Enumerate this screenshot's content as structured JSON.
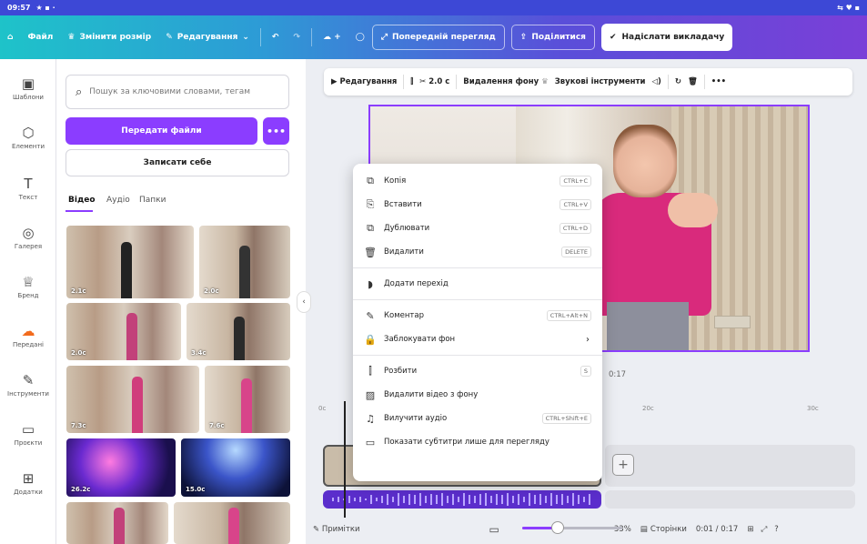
{
  "status": {
    "time": "09:57",
    "right": "⇆ ♥ ▪"
  },
  "topbar": {
    "home_icon": "home-icon",
    "file": "Файл",
    "resize": "Змінити розмір",
    "edit": "Редагування",
    "preview": "Попередній перегляд",
    "share": "Поділитися",
    "send": "Надіслати викладачу"
  },
  "rail": [
    {
      "label": "Шаблони",
      "icon": "▣"
    },
    {
      "label": "Елементи",
      "icon": "⬡"
    },
    {
      "label": "Текст",
      "icon": "T"
    },
    {
      "label": "Галерея",
      "icon": "◎"
    },
    {
      "label": "Бренд",
      "icon": "♕"
    },
    {
      "label": "Передані",
      "icon": "☁"
    },
    {
      "label": "Інструменти",
      "icon": "✎"
    },
    {
      "label": "Проєкти",
      "icon": "▭"
    },
    {
      "label": "Додатки",
      "icon": "⊞"
    }
  ],
  "panel": {
    "search_placeholder": "Пошук за ключовими словами, тегам",
    "upload": "Передати файли",
    "upload_more": "•••",
    "record": "Записати себе",
    "tabs": [
      "Відео",
      "Аудіо",
      "Папки"
    ],
    "thumbs": [
      "2.1с",
      "2.0с",
      "2.0с",
      "3.4с",
      "7.3с",
      "7.6с",
      "26.2с",
      "15.0с"
    ]
  },
  "ctxbar": {
    "edit": "Редагування",
    "duration": "2.0 с",
    "bg_remove": "Видалення фону",
    "audio_tools": "Звукові інструменти"
  },
  "menu": [
    {
      "icon": "⧉",
      "label": "Копія",
      "shortcut": "CTRL+C"
    },
    {
      "icon": "⎘",
      "label": "Вставити",
      "shortcut": "CTRL+V"
    },
    {
      "icon": "⧉",
      "label": "Дублювати",
      "shortcut": "CTRL+D"
    },
    {
      "icon": "🗑",
      "label": "Видалити",
      "shortcut": "DELETE"
    },
    {
      "icon": "◗",
      "label": "Додати перехід",
      "shortcut": ""
    },
    {
      "icon": "✎",
      "label": "Коментар",
      "shortcut": "CTRL+Alt+N"
    },
    {
      "icon": "🔒",
      "label": "Заблокувати фон",
      "shortcut": ""
    },
    {
      "icon": "⫿",
      "label": "Розбити",
      "shortcut": "S"
    },
    {
      "icon": "▨",
      "label": "Видалити відео з фону",
      "shortcut": ""
    },
    {
      "icon": "♫",
      "label": "Вилучити аудіо",
      "shortcut": "CTRL+Shift+E"
    },
    {
      "icon": "▭",
      "label": "Показати субтитри лише для перегляду",
      "shortcut": ""
    }
  ],
  "timeline": {
    "ticks": [
      "0с",
      "20с",
      "30с"
    ],
    "current": "0:17"
  },
  "bottom": {
    "notes": "Примітки",
    "zoom": "33%",
    "pages": "Сторінки",
    "time": "0:01 / 0:17",
    "zoom_level": 0.33
  },
  "colors": {
    "accent": "#8b3dff",
    "topbar_start": "#1ec3c9",
    "topbar_end": "#7a3fd8"
  }
}
